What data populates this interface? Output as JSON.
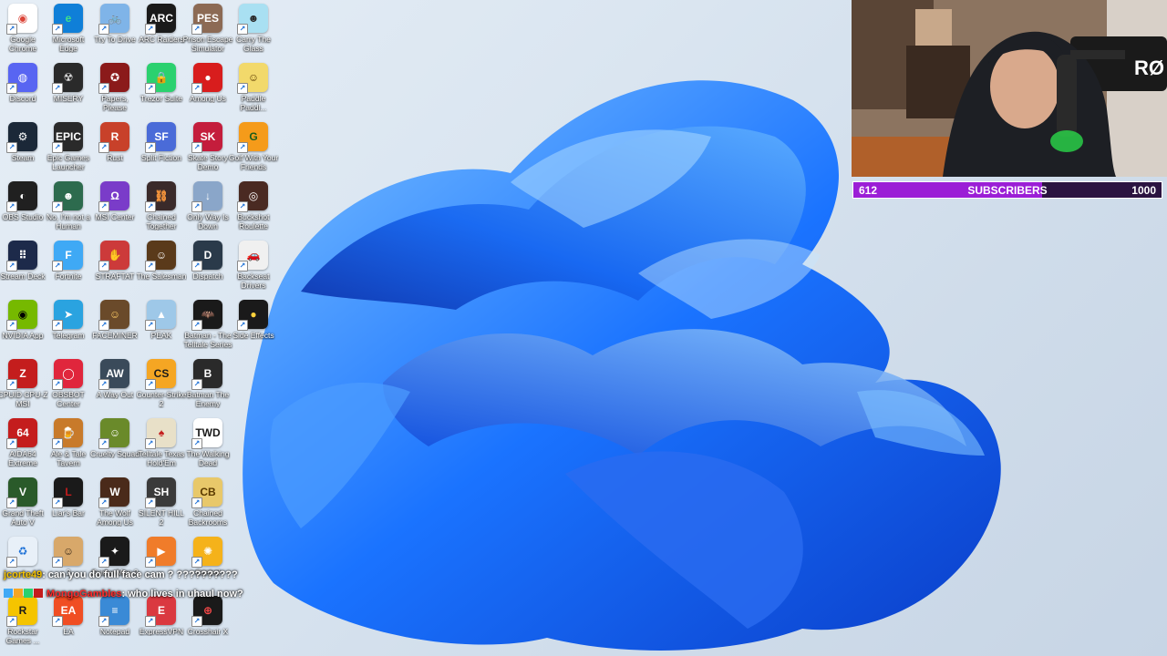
{
  "desktop": {
    "icons": [
      {
        "label": "Google Chrome",
        "bg": "#ffffff",
        "fg": "#db4437",
        "glyph": "◉"
      },
      {
        "label": "Microsoft Edge",
        "bg": "#0f7fd8",
        "fg": "#3fe08a",
        "glyph": "e"
      },
      {
        "label": "Try To Drive",
        "bg": "#7fb4e8",
        "fg": "#ffffff",
        "glyph": "🚲"
      },
      {
        "label": "ARC Raiders",
        "bg": "#1a1a1a",
        "fg": "#ffffff",
        "glyph": "ARC"
      },
      {
        "label": "Prison Escape Simulator",
        "bg": "#8c6a54",
        "fg": "#ffffff",
        "glyph": "PES"
      },
      {
        "label": "Carry The Glass",
        "bg": "#a9e0f2",
        "fg": "#2a2a2a",
        "glyph": "☻"
      },
      {
        "label": "Discord",
        "bg": "#5865f2",
        "fg": "#ffffff",
        "glyph": "◍"
      },
      {
        "label": "MISERY",
        "bg": "#2a2a2a",
        "fg": "#dddddd",
        "glyph": "☢"
      },
      {
        "label": "Papers, Please",
        "bg": "#8b1a1a",
        "fg": "#ffffff",
        "glyph": "✪"
      },
      {
        "label": "Trezor Suite",
        "bg": "#2bd16f",
        "fg": "#0b3d1f",
        "glyph": "🔒"
      },
      {
        "label": "Among Us",
        "bg": "#d81d1d",
        "fg": "#ffffff",
        "glyph": "●"
      },
      {
        "label": "Paddle Paddl...",
        "bg": "#f2d96b",
        "fg": "#5a3a00",
        "glyph": "☺"
      },
      {
        "label": "Steam",
        "bg": "#1b2838",
        "fg": "#ffffff",
        "glyph": "⚙"
      },
      {
        "label": "Epic Games Launcher",
        "bg": "#2a2a2a",
        "fg": "#ffffff",
        "glyph": "EPIC"
      },
      {
        "label": "Rust",
        "bg": "#c8412a",
        "fg": "#ffffff",
        "glyph": "R"
      },
      {
        "label": "Split Fiction",
        "bg": "#4a6bd8",
        "fg": "#ffffff",
        "glyph": "SF"
      },
      {
        "label": "Skate Story Demo",
        "bg": "#c41d3c",
        "fg": "#ffffff",
        "glyph": "SK"
      },
      {
        "label": "Golf With Your Friends",
        "bg": "#f59b1a",
        "fg": "#1a5c1a",
        "glyph": "G"
      },
      {
        "label": "OBS Studio",
        "bg": "#202020",
        "fg": "#ffffff",
        "glyph": "◐"
      },
      {
        "label": "No, I'm not a Human",
        "bg": "#2d6b4e",
        "fg": "#ffffff",
        "glyph": "☻"
      },
      {
        "label": "MSI Center",
        "bg": "#7a3cc9",
        "fg": "#ffffff",
        "glyph": "Ω"
      },
      {
        "label": "Chained Together",
        "bg": "#3a2a2a",
        "fg": "#ff9a3c",
        "glyph": "⛓"
      },
      {
        "label": "Only Way Is Down",
        "bg": "#8aa6c9",
        "fg": "#ffffff",
        "glyph": "↓"
      },
      {
        "label": "Buckshot Roulette",
        "bg": "#4a2a22",
        "fg": "#ffffff",
        "glyph": "◎"
      },
      {
        "label": "Stream Deck",
        "bg": "#1d2a4a",
        "fg": "#ffffff",
        "glyph": "⠿"
      },
      {
        "label": "Fortnite",
        "bg": "#3fa9f5",
        "fg": "#ffffff",
        "glyph": "F"
      },
      {
        "label": "STRAFTAT",
        "bg": "#cc3a3a",
        "fg": "#ffffff",
        "glyph": "✋"
      },
      {
        "label": "The Salesman",
        "bg": "#5a3a1a",
        "fg": "#ffffff",
        "glyph": "☺"
      },
      {
        "label": "Dispatch",
        "bg": "#2a3a4a",
        "fg": "#ffffff",
        "glyph": "D"
      },
      {
        "label": "Backseat Drivers",
        "bg": "#f0f0f0",
        "fg": "#c41d1d",
        "glyph": "🚗"
      },
      {
        "label": "NVIDIA App",
        "bg": "#76b900",
        "fg": "#000000",
        "glyph": "◉"
      },
      {
        "label": "Telegram",
        "bg": "#2aa3e0",
        "fg": "#ffffff",
        "glyph": "➤"
      },
      {
        "label": "FACEMINER",
        "bg": "#6a4a2a",
        "fg": "#ffcc66",
        "glyph": "☺"
      },
      {
        "label": "PEAK",
        "bg": "#9ec8e8",
        "fg": "#ffffff",
        "glyph": "▲"
      },
      {
        "label": "Batman - The Telltale Series",
        "bg": "#1a1a1a",
        "fg": "#ffffff",
        "glyph": "🦇"
      },
      {
        "label": "Side Effects",
        "bg": "#1a1a1a",
        "fg": "#ffd23c",
        "glyph": "●"
      },
      {
        "label": "CPUID CPU-Z MSI",
        "bg": "#c41d1d",
        "fg": "#ffffff",
        "glyph": "Z"
      },
      {
        "label": "OBSBOT Center",
        "bg": "#e0263c",
        "fg": "#ffffff",
        "glyph": "◯"
      },
      {
        "label": "A Way Out",
        "bg": "#3a4a5a",
        "fg": "#ffffff",
        "glyph": "AW"
      },
      {
        "label": "Counter-Strike 2",
        "bg": "#f5a623",
        "fg": "#1a1a1a",
        "glyph": "CS"
      },
      {
        "label": "Batman The Enemy",
        "bg": "#2a2a2a",
        "fg": "#ffffff",
        "glyph": "B"
      },
      {
        "label": "",
        "bg": "transparent",
        "fg": "#ffffff",
        "glyph": ""
      },
      {
        "label": "AIDA64 Extreme",
        "bg": "#c41d1d",
        "fg": "#ffffff",
        "glyph": "64"
      },
      {
        "label": "Ale & Tale Tavern",
        "bg": "#c87a2a",
        "fg": "#ffffff",
        "glyph": "🍺"
      },
      {
        "label": "Cruelty Squad",
        "bg": "#6a8a2a",
        "fg": "#ffffff",
        "glyph": "☺"
      },
      {
        "label": "Telltale Texas Hold'Em",
        "bg": "#e8e0c8",
        "fg": "#c41d1d",
        "glyph": "♠"
      },
      {
        "label": "The Walking Dead",
        "bg": "#ffffff",
        "fg": "#1a1a1a",
        "glyph": "TWD"
      },
      {
        "label": "",
        "bg": "transparent",
        "fg": "#ffffff",
        "glyph": ""
      },
      {
        "label": "Grand Theft Auto V",
        "bg": "#2a5a2a",
        "fg": "#ffffff",
        "glyph": "V"
      },
      {
        "label": "Liar's Bar",
        "bg": "#1a1a1a",
        "fg": "#c41d1d",
        "glyph": "L"
      },
      {
        "label": "The Wolf Among Us",
        "bg": "#4a2a1a",
        "fg": "#ffffff",
        "glyph": "W"
      },
      {
        "label": "SILENT HILL 2",
        "bg": "#3a3a3a",
        "fg": "#ffffff",
        "glyph": "SH"
      },
      {
        "label": "Chained Backrooms",
        "bg": "#e8c86a",
        "fg": "#5a3a00",
        "glyph": "CB"
      },
      {
        "label": "",
        "bg": "transparent",
        "fg": "#ffffff",
        "glyph": ""
      },
      {
        "label": "",
        "bg": "#e8f0f8",
        "fg": "#1a6fd6",
        "glyph": "♻"
      },
      {
        "label": "2",
        "bg": "#d8a86a",
        "fg": "#3a2a1a",
        "glyph": "☺"
      },
      {
        "label": "Spider-Man 2",
        "bg": "#1a1a1a",
        "fg": "#ffffff",
        "glyph": "✦"
      },
      {
        "label": "",
        "bg": "#f07c2a",
        "fg": "#ffffff",
        "glyph": "▶"
      },
      {
        "label": "Control",
        "bg": "#f5b21a",
        "fg": "#ffffff",
        "glyph": "✺"
      },
      {
        "label": "",
        "bg": "transparent",
        "fg": "#ffffff",
        "glyph": ""
      },
      {
        "label": "Rockstar Games ...",
        "bg": "#f5c400",
        "fg": "#1a1a1a",
        "glyph": "R"
      },
      {
        "label": "EA",
        "bg": "#f04e23",
        "fg": "#ffffff",
        "glyph": "EA"
      },
      {
        "label": "Notepad",
        "bg": "#3a8ad6",
        "fg": "#ffffff",
        "glyph": "≡"
      },
      {
        "label": "ExpressVPN",
        "bg": "#da3940",
        "fg": "#ffffff",
        "glyph": "E"
      },
      {
        "label": "Crosshair X",
        "bg": "#1a1a1a",
        "fg": "#ff4a4a",
        "glyph": "⊕"
      },
      {
        "label": "",
        "bg": "transparent",
        "fg": "#ffffff",
        "glyph": ""
      }
    ]
  },
  "subscriber_goal": {
    "current": "612",
    "label": "SUBSCRIBERS",
    "target": "1000",
    "progress": 0.612,
    "fill_color": "#9b1ed6"
  },
  "chat": [
    {
      "user": "jcorte49",
      "user_color": "#f5c400",
      "message": ": can you do full face cam ? ??????????"
    },
    {
      "user": "MongoGambles",
      "user_color": "#ff2a2a",
      "message": ": who lives in uhaul now?"
    }
  ]
}
